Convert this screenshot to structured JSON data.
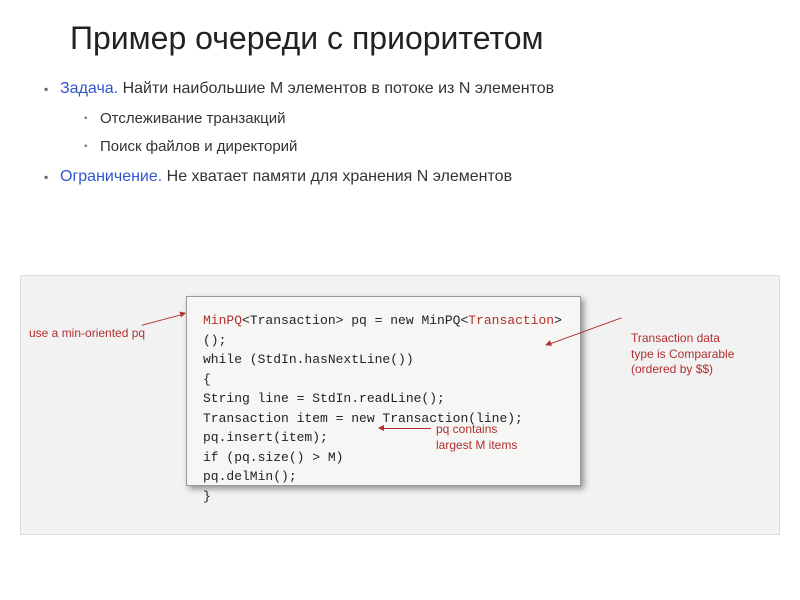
{
  "title": "Пример очереди с приоритетом",
  "bullets": {
    "item1_label": "Задача.",
    "item1_text": " Найти наибольшие M элементов в потоке из N элементов",
    "sub1": "Отслеживание транзакций",
    "sub2": "Поиск файлов и директорий",
    "item2_label": "Ограничение.",
    "item2_text": " Не хватает памяти для хранения N элементов"
  },
  "code": {
    "l1a": "MinPQ",
    "l1b": "<Transaction> pq = new MinPQ<",
    "l1c": "Transaction",
    "l1d": ">();",
    "l2": "",
    "l3": "while (StdIn.hasNextLine())",
    "l4": "{",
    "l5": "   String line = StdIn.readLine();",
    "l6": "   Transaction item = new Transaction(line);",
    "l7": "   pq.insert(item);",
    "l8": "   if (pq.size() > M)",
    "l9": "      pq.delMin();",
    "l10": "}"
  },
  "annotations": {
    "left": "use a min-oriented pq",
    "right_l1": "Transaction data",
    "right_l2": "type is Comparable",
    "right_l3": "(ordered by $$)",
    "center_l1": "pq contains",
    "center_l2": "largest M items"
  }
}
